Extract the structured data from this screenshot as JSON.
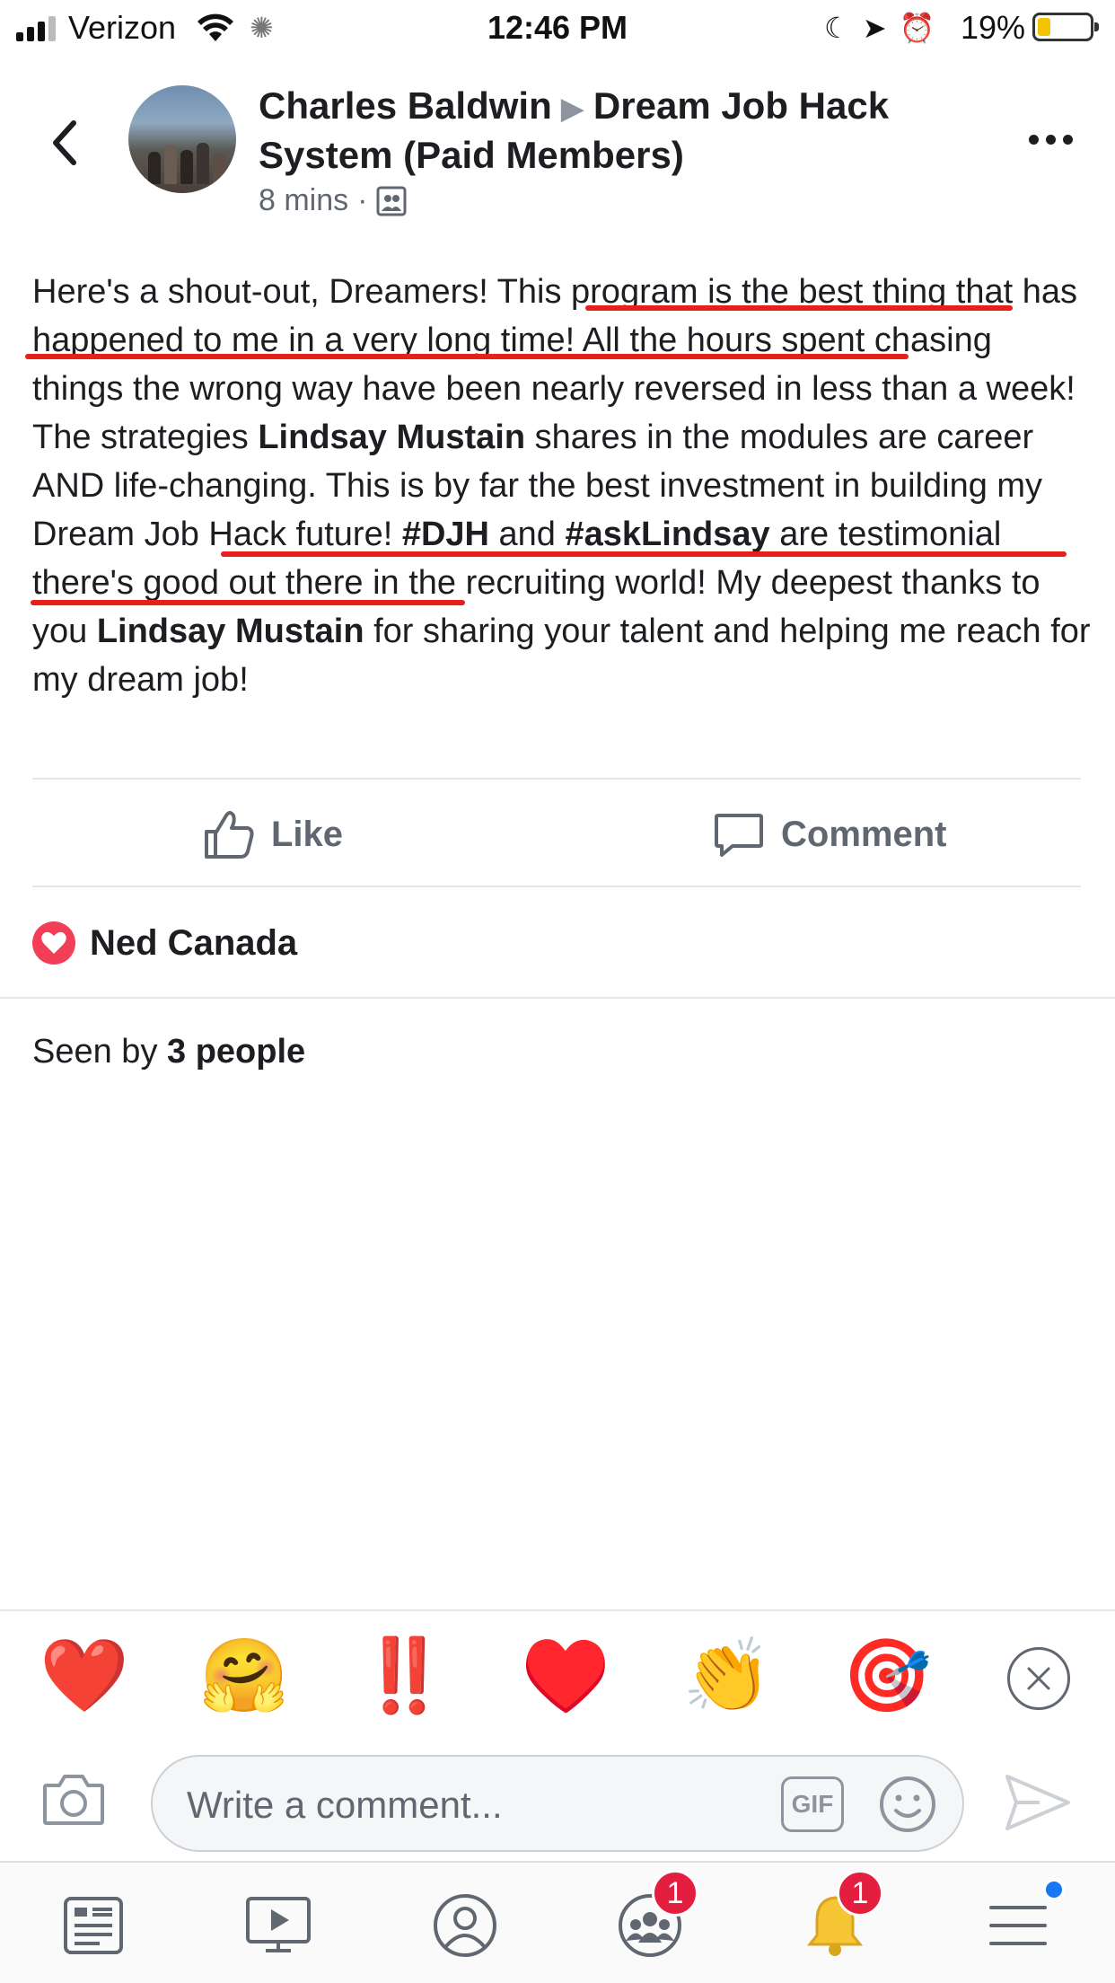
{
  "status_bar": {
    "carrier": "Verizon",
    "time": "12:46 PM",
    "battery": "19%",
    "battery_level": 0.19
  },
  "header": {
    "author": "Charles Baldwin",
    "group": "Dream Job Hack System (Paid Members)",
    "time_ago": "8 mins",
    "separator": "·",
    "audience_icon": "group-icon"
  },
  "post": {
    "text": {
      "s1": "Here's a shout-out, Dreamers!   ",
      "s2": "This program is the best thing that has happened to me in a very long time!",
      "s3": "   All the hours spent chasing things the wrong way have been nearly reversed in less than a week!   The strategies ",
      "s4": "Lindsay Mustain",
      "s5": " shares in the modules are career AND life-changing.   ",
      "s6": "This is by far the best investment in building my Dream Job Hack future!",
      "s7": "   ",
      "s8": "#DJH",
      "s9": " and ",
      "s10": "#askLindsay",
      "s11": " are testimonial there's good out there in the recruiting world!  My deepest thanks to you ",
      "s12": "Lindsay Mustain",
      "s13": " for sharing your talent and helping me reach for my dream job!"
    },
    "annotation_color": "#e8201a"
  },
  "actions": {
    "like_label": "Like",
    "comment_label": "Comment"
  },
  "reactions": {
    "icon": "heart-icon",
    "names": "Ned Canada"
  },
  "seen_by": {
    "prefix": "Seen by ",
    "count": "3 people"
  },
  "emoji_suggestions": [
    "❤️",
    "🤗",
    "‼️",
    "♥️",
    "👏",
    "🎯"
  ],
  "composer": {
    "placeholder": "Write a comment...",
    "gif_label": "GIF"
  },
  "tabbar": {
    "tabs": [
      {
        "icon": "news-feed-icon"
      },
      {
        "icon": "watch-icon"
      },
      {
        "icon": "profile-icon"
      },
      {
        "icon": "groups-icon",
        "badge": "1"
      },
      {
        "icon": "notifications-icon",
        "badge": "1"
      },
      {
        "icon": "menu-icon"
      }
    ]
  },
  "colors": {
    "accent": "#1877f2",
    "badge": "#e41e3f",
    "love": "#f33e58",
    "text": "#1c1e21",
    "muted": "#606770"
  }
}
